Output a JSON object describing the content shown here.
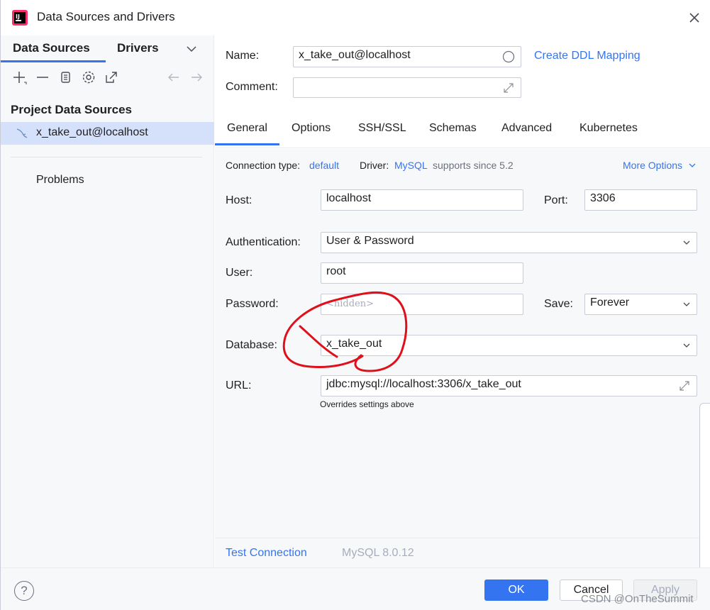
{
  "window": {
    "title": "Data Sources and Drivers"
  },
  "left": {
    "tabs": [
      "Data Sources",
      "Drivers"
    ],
    "section_title": "Project Data Sources",
    "data_source": "x_take_out@localhost",
    "problems": "Problems"
  },
  "form": {
    "name_label": "Name:",
    "name_value": "x_take_out@localhost",
    "ddl_link": "Create DDL Mapping",
    "comment_label": "Comment:",
    "comment_value": ""
  },
  "tabs": [
    "General",
    "Options",
    "SSH/SSL",
    "Schemas",
    "Advanced",
    "Kubernetes"
  ],
  "general": {
    "conn_type_label": "Connection type:",
    "conn_type_value": "default",
    "driver_label": "Driver:",
    "driver_value": "MySQL",
    "driver_note": "supports since 5.2",
    "more_options": "More Options",
    "host_label": "Host:",
    "host_value": "localhost",
    "port_label": "Port:",
    "port_value": "3306",
    "auth_label": "Authentication:",
    "auth_value": "User & Password",
    "user_label": "User:",
    "user_value": "root",
    "password_label": "Password:",
    "password_placeholder": "<hidden>",
    "save_label": "Save:",
    "save_value": "Forever",
    "database_label": "Database:",
    "database_value": "x_take_out",
    "url_label": "URL:",
    "url_value": "jdbc:mysql://localhost:3306/x_take_out",
    "url_note": "Overrides settings above"
  },
  "footer": {
    "test_connection": "Test Connection",
    "server_version": "MySQL 8.0.12"
  },
  "buttons": {
    "help": "?",
    "ok": "OK",
    "cancel": "Cancel",
    "apply": "Apply"
  },
  "watermark": "CSDN @OnTheSummit",
  "colors": {
    "accent": "#3574f0",
    "selection": "#d5e1fb",
    "annotation": "#e0101a"
  }
}
